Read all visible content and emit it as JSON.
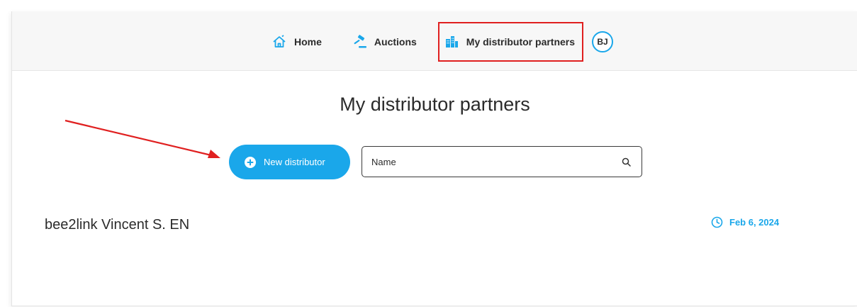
{
  "nav": {
    "home_label": "Home",
    "auctions_label": "Auctions",
    "partners_label": "My distributor partners",
    "avatar_initials": "BJ"
  },
  "page": {
    "title": "My distributor partners"
  },
  "actions": {
    "new_distributor_label": "New distributor",
    "search_placeholder": "Name"
  },
  "partners": [
    {
      "name": "bee2link Vincent S. EN",
      "date": "Feb 6, 2024"
    }
  ],
  "icons": {
    "home": "home-icon",
    "auctions": "gavel-icon",
    "partners": "buildings-icon",
    "new": "plus-circle-icon",
    "search": "search-icon",
    "date": "clock-icon"
  },
  "colors": {
    "accent": "#1aa7ea",
    "highlight_box": "#e02020",
    "annotation_arrow": "#e02020"
  }
}
